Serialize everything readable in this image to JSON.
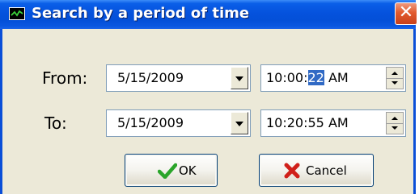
{
  "window": {
    "title": "Search by a period of time",
    "close_symbol": "✕"
  },
  "icons": {
    "app": "chart-window-icon",
    "close": "close-icon",
    "ok": "checkmark-icon",
    "cancel": "red-x-icon"
  },
  "from": {
    "label": "From:",
    "date": "5/15/2009",
    "time_prefix": "10:00:",
    "time_selected": "22",
    "time_suffix": " AM"
  },
  "to": {
    "label": "To:",
    "date": "5/15/2009",
    "time": "10:20:55 AM"
  },
  "buttons": {
    "ok": "OK",
    "cancel": "Cancel"
  },
  "colors": {
    "titlebar": "#0450d8",
    "close": "#e25a2e",
    "selection": "#316ac5",
    "ok_icon": "#2aa52a",
    "cancel_icon": "#d0201a"
  }
}
